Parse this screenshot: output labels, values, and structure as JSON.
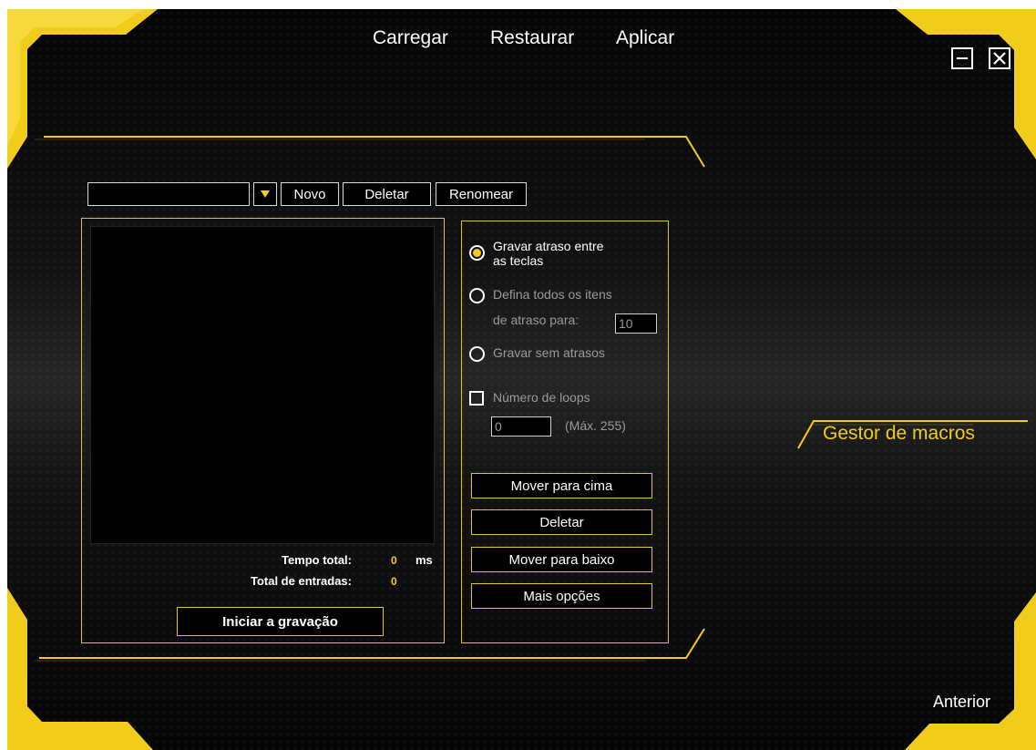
{
  "top_menu": {
    "load": "Carregar",
    "restore": "Restaurar",
    "apply": "Aplicar"
  },
  "window": {
    "minimize_icon": "minus-icon",
    "close_icon": "x-icon"
  },
  "toolbar": {
    "macro_select_value": "",
    "new_label": "Novo",
    "delete_label": "Deletar",
    "rename_label": "Renomear"
  },
  "stats": {
    "total_time_label": "Tempo total:",
    "total_time_value": "0",
    "total_time_unit": "ms",
    "total_entries_label": "Total de entradas:",
    "total_entries_value": "0"
  },
  "record_button_label": "Iniciar a gravação",
  "options": {
    "record_delay_line1": "Gravar atraso entre",
    "record_delay_line2": "as teclas",
    "set_all_delay_line1": "Defina todos os itens",
    "set_all_delay_line2": "de atraso para:",
    "set_all_delay_value": "10",
    "no_delay": "Gravar sem atrasos",
    "loops_label": "Número de loops",
    "loops_value": "0",
    "loops_max": "(Máx. 255)",
    "selected": "record_delay"
  },
  "actions": {
    "move_up": "Mover para cima",
    "delete": "Deletar",
    "move_down": "Mover para baixo",
    "more_options": "Mais opções"
  },
  "side_title": "Gestor de macros",
  "back_label": "Anterior",
  "colors": {
    "accent": "#f2cc1a",
    "background": "#0c0c0c",
    "panel_border": "#e5c41f"
  }
}
